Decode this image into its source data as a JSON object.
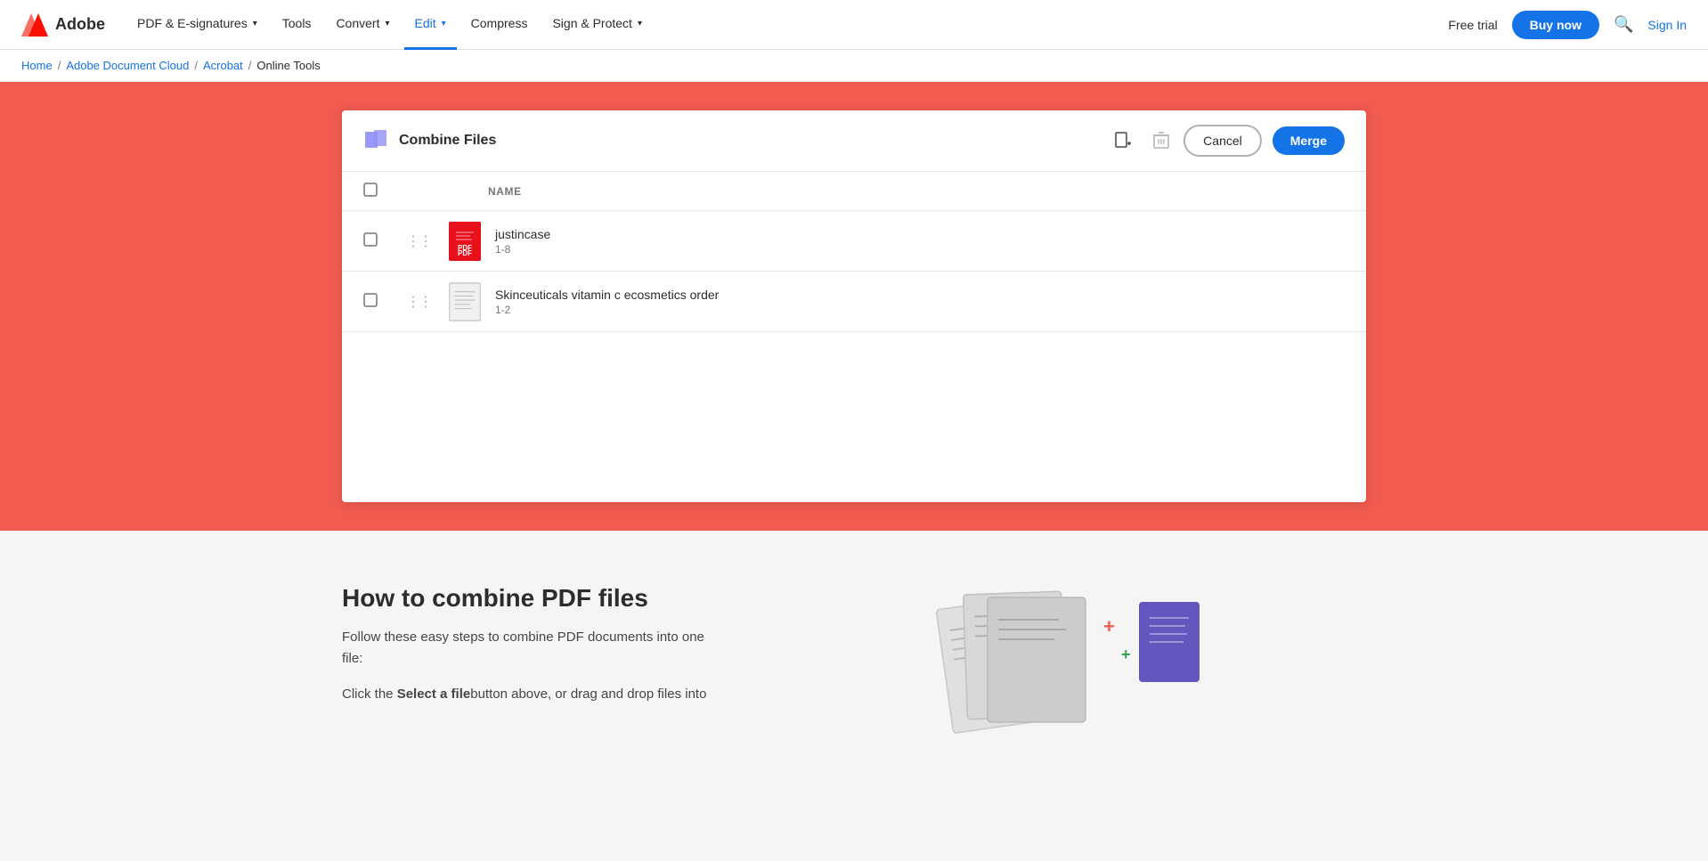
{
  "navbar": {
    "logo_text": "Adobe",
    "nav_items": [
      {
        "id": "pdf-esig",
        "label": "PDF & E-signatures",
        "has_chevron": true,
        "active": false
      },
      {
        "id": "tools",
        "label": "Tools",
        "has_chevron": false,
        "active": false
      },
      {
        "id": "convert",
        "label": "Convert",
        "has_chevron": true,
        "active": false
      },
      {
        "id": "edit",
        "label": "Edit",
        "has_chevron": true,
        "active": true
      },
      {
        "id": "compress",
        "label": "Compress",
        "has_chevron": false,
        "active": false
      },
      {
        "id": "sign-protect",
        "label": "Sign & Protect",
        "has_chevron": true,
        "active": false
      }
    ],
    "free_trial": "Free trial",
    "buy_now": "Buy now",
    "sign_in": "Sign In"
  },
  "breadcrumb": {
    "items": [
      {
        "label": "Home",
        "link": true
      },
      {
        "label": "Adobe Document Cloud",
        "link": true
      },
      {
        "label": "Acrobat",
        "link": true
      },
      {
        "label": "Online Tools",
        "link": false
      }
    ]
  },
  "combine_panel": {
    "title": "Combine Files",
    "cancel_label": "Cancel",
    "merge_label": "Merge",
    "column_name": "NAME",
    "files": [
      {
        "name": "justincase",
        "pages": "1-8",
        "type": "pdf"
      },
      {
        "name": "Skinceuticals vitamin c ecosmetics order",
        "pages": "1-2",
        "type": "generic"
      }
    ]
  },
  "how_to": {
    "title": "How to combine PDF files",
    "description": "Follow these easy steps to combine PDF documents into one file:",
    "step1_prefix": "Click the ",
    "step1_bold": "Select a file",
    "step1_suffix": "button above, or drag and drop files into"
  }
}
